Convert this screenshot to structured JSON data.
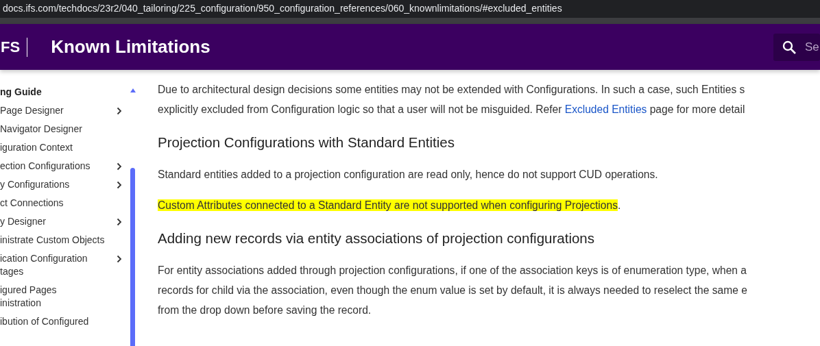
{
  "browser": {
    "url": "docs.ifs.com/techdocs/23r2/040_tailoring/225_configuration/950_configuration_references/060_knownlimitations/#excluded_entities"
  },
  "header": {
    "logo": "FS",
    "title": "Known Limitations",
    "search": {
      "placeholder": "Se"
    }
  },
  "sidebar": {
    "title": "ng Guide",
    "items": [
      {
        "label": "Page Designer",
        "expandable": true
      },
      {
        "label": "Navigator Designer",
        "expandable": false
      },
      {
        "label": "iguration Context",
        "expandable": false
      },
      {
        "label": "ection Configurations",
        "expandable": true
      },
      {
        "label": "y Configurations",
        "expandable": true
      },
      {
        "label": "ct Connections",
        "expandable": false
      },
      {
        "label": "y Designer",
        "expandable": true
      },
      {
        "label": "inistrate Custom Objects",
        "expandable": false
      },
      {
        "label": "ication Configuration\ntages",
        "expandable": true
      },
      {
        "label": "igured Pages\ninistration",
        "expandable": false
      },
      {
        "label": "ibution of Configured",
        "expandable": false
      }
    ]
  },
  "content": [
    {
      "kind": "paragraph",
      "lines": [
        [
          {
            "kind": "text",
            "text": "Due to architectural design decisions some entities may not be extended with Configurations. In such a case, such Entities s"
          }
        ],
        [
          {
            "kind": "text",
            "text": "explicitly excluded from Configuration logic so that a user will not be misguided. Refer "
          },
          {
            "kind": "link",
            "text": "Excluded Entities"
          },
          {
            "kind": "text",
            "text": " page for more detail"
          }
        ]
      ]
    },
    {
      "kind": "heading",
      "text": "Projection Configurations with Standard Entities"
    },
    {
      "kind": "paragraph",
      "lines": [
        [
          {
            "kind": "text",
            "text": "Standard entities added to a projection configuration are read only, hence do not support CUD operations."
          }
        ]
      ]
    },
    {
      "kind": "paragraph",
      "lines": [
        [
          {
            "kind": "highlight",
            "text": "Custom Attributes connected to a Standard Entity are not supported when configuring Projections"
          },
          {
            "kind": "text",
            "text": "."
          }
        ]
      ]
    },
    {
      "kind": "heading",
      "text": "Adding new records via entity associations of projection configurations"
    },
    {
      "kind": "paragraph",
      "lines": [
        [
          {
            "kind": "text",
            "text": "For entity associations added through projection configurations, if one of the association keys is of enumeration type, when a"
          }
        ],
        [
          {
            "kind": "text",
            "text": "records for child via the association, even though the enum value is set by default, it is always needed to reselect the same e"
          }
        ],
        [
          {
            "kind": "text",
            "text": "from the drop down before saving the record."
          }
        ]
      ]
    }
  ]
}
